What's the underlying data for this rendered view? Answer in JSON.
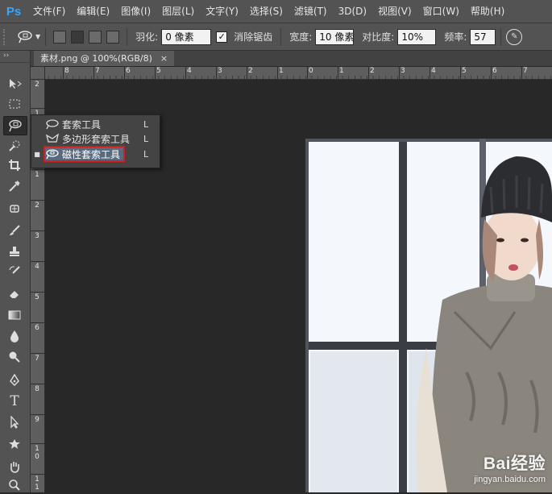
{
  "app": {
    "logo": "Ps"
  },
  "menubar": {
    "items": [
      "文件(F)",
      "编辑(E)",
      "图像(I)",
      "图层(L)",
      "文字(Y)",
      "选择(S)",
      "滤镜(T)",
      "3D(D)",
      "视图(V)",
      "窗口(W)",
      "帮助(H)"
    ]
  },
  "options": {
    "feather_label": "羽化:",
    "feather_value": "0 像素",
    "antialias_label": "消除锯齿",
    "antialias_checked": true,
    "width_label": "宽度:",
    "width_value": "10 像素",
    "contrast_label": "对比度:",
    "contrast_value": "10%",
    "frequency_label": "频率:",
    "frequency_value": "57"
  },
  "document": {
    "tab_title": "素材.png @ 100%(RGB/8)",
    "close_glyph": "×"
  },
  "ruler_h": [
    "8",
    "7",
    "6",
    "5",
    "4",
    "3",
    "2",
    "1",
    "0",
    "1",
    "2",
    "3",
    "4",
    "5",
    "6",
    "7"
  ],
  "ruler_v": [
    "2",
    "1",
    "0",
    "1",
    "2",
    "3",
    "4",
    "5",
    "6",
    "7",
    "8",
    "9",
    "1 0",
    "1 1"
  ],
  "flyout": {
    "items": [
      {
        "label": "套索工具",
        "key": "L",
        "icon": "lasso-icon",
        "selected": false
      },
      {
        "label": "多边形套索工具",
        "key": "L",
        "icon": "polygonal-lasso-icon",
        "selected": false
      },
      {
        "label": "磁性套索工具",
        "key": "L",
        "icon": "magnetic-lasso-icon",
        "selected": true
      }
    ],
    "highlight_color": "#d01f1f"
  },
  "watermark": {
    "main": "Bai经验",
    "sub": "jingyan.baidu.com"
  },
  "colors": {
    "menubar_bg": "#535353",
    "canvas_bg": "#282828",
    "logo_blue": "#31a8ff"
  }
}
